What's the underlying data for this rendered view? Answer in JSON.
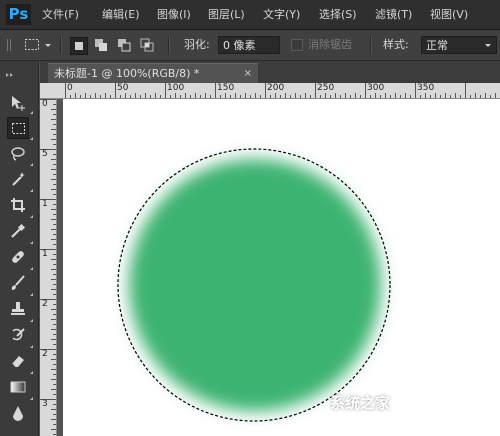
{
  "app": {
    "logo": "Ps"
  },
  "menu": [
    {
      "label": "文件(F)"
    },
    {
      "label": "编辑(E)"
    },
    {
      "label": "图像(I)"
    },
    {
      "label": "图层(L)"
    },
    {
      "label": "文字(Y)"
    },
    {
      "label": "选择(S)"
    },
    {
      "label": "滤镜(T)"
    },
    {
      "label": "视图(V)"
    }
  ],
  "options": {
    "feather_label": "羽化:",
    "feather_value": "0 像素",
    "antialias_label": "消除锯齿",
    "style_label": "样式:",
    "style_value": "正常"
  },
  "document": {
    "tab_title": "未标题-1 @ 100%(RGB/8) *",
    "close_glyph": "×"
  },
  "rulers": {
    "h_labels": [
      "0",
      "50",
      "100",
      "150",
      "200",
      "250",
      "300",
      "350"
    ],
    "v_labels": [
      "0",
      "5",
      "1",
      "1",
      "2",
      "2",
      "3"
    ]
  },
  "canvas": {
    "shape_color": "#3cb371",
    "background": "#ffffff"
  },
  "watermark": {
    "text": "系统之家"
  }
}
